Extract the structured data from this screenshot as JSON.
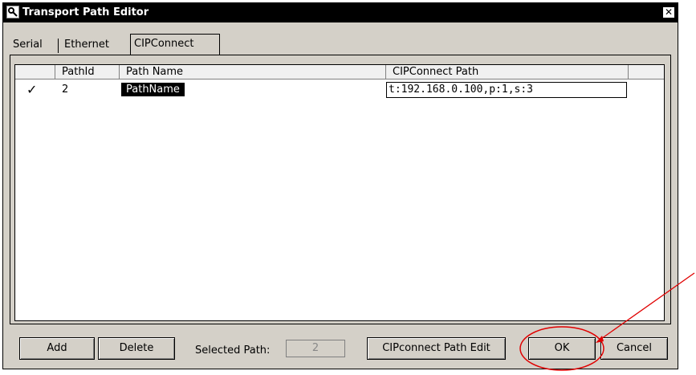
{
  "window": {
    "title": "Transport Path Editor",
    "close_glyph": "✕"
  },
  "tabs": [
    {
      "label": "Serial"
    },
    {
      "label": "Ethernet"
    },
    {
      "label": "CIPConnect"
    }
  ],
  "grid": {
    "columns": [
      "PathId",
      "Path Name",
      "CIPConnect Path"
    ],
    "rows": [
      {
        "check": "✓",
        "path_id": "2",
        "path_name": "PathName",
        "path": "t:192.168.0.100,p:1,s:3"
      }
    ]
  },
  "footer": {
    "add_label": "Add",
    "delete_label": "Delete",
    "selected_path_label": "Selected Path:",
    "selected_path_value": "2",
    "cip_edit_label": "CIPconnect Path Edit",
    "ok_label": "OK",
    "cancel_label": "Cancel"
  },
  "annotation": {
    "color": "#e00000"
  }
}
